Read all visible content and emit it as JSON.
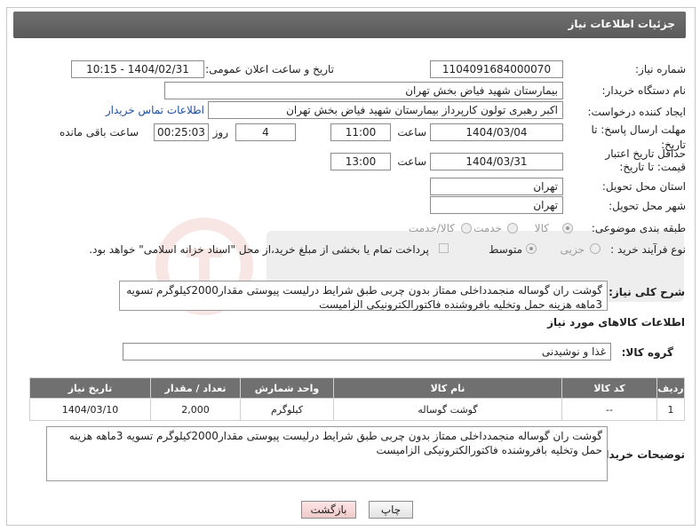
{
  "header": {
    "title": "جزئیات اطلاعات نیاز"
  },
  "form": {
    "need_number_label": "شماره نیاز:",
    "need_number": "1104091684000070",
    "announce_label": "تاریخ و ساعت اعلان عمومی:",
    "announce_value": "1404/02/31 - 10:15",
    "buyer_org_label": "نام دستگاه خریدار:",
    "buyer_org": "بیمارستان شهید فیاض بخش تهران",
    "creator_label": "ایجاد کننده درخواست:",
    "creator": "اکبر رهبری تولون کارپرداز بیمارستان شهید فیاض بخش تهران",
    "buyer_contact_link": "اطلاعات تماس خریدار",
    "reply_deadline_label": "مهلت ارسال پاسخ: تا تاریخ:",
    "reply_date": "1404/03/04",
    "time_label": "ساعت",
    "reply_time": "11:00",
    "days_value": "4",
    "days_label": "روز و",
    "remaining_time": "00:25:03",
    "remaining_label": "ساعت باقی مانده",
    "price_validity_label": "حداقل تاریخ اعتبار قیمت: تا تاریخ:",
    "price_date": "1404/03/31",
    "price_time": "13:00",
    "province_label": "استان محل تحویل:",
    "province": "تهران",
    "city_label": "شهر محل تحویل:",
    "city": "تهران",
    "category_label": "طبقه بندی موضوعی:",
    "category_options": [
      "کالا",
      "خدمت",
      "کالا/خدمت"
    ],
    "process_label": "نوع فرآیند خرید :",
    "process_options": [
      "جزیی",
      "متوسط"
    ],
    "payment_note": "پرداخت تمام یا بخشی از مبلغ خرید،از محل \"اسناد خزانه اسلامی\" خواهد بود.",
    "description_label": "شرح کلی نیاز:",
    "description": "گوشت ران گوساله منجمدداخلی ممتاز بدون چربی طبق شرایط درلیست پیوستی مقدار2000کیلوگرم تسویه 3ماهه هزینه حمل وتخلیه بافروشنده فاکتورالکترونیکی الزامیست"
  },
  "goods": {
    "section_title": "اطلاعات کالاهای مورد نیاز",
    "group_label": "گروه کالا:",
    "group_value": "غذا و نوشیدنی",
    "columns": [
      "ردیف",
      "کد کالا",
      "نام کالا",
      "واحد شمارش",
      "تعداد / مقدار",
      "تاریخ نیاز"
    ],
    "rows": [
      {
        "row": "1",
        "code": "--",
        "name": "گوشت گوساله",
        "unit": "کیلوگرم",
        "qty": "2,000",
        "date": "1404/03/10"
      }
    ]
  },
  "buyer_notes": {
    "label": "توضیحات خریدار:",
    "text": "گوشت ران گوساله منجمدداخلی ممتاز بدون چربی طبق شرایط درلیست پیوستی مقدار2000کیلوگرم تسویه 3ماهه هزینه حمل وتخلیه بافروشنده فاکتورالکترونیکی الزامیست"
  },
  "buttons": {
    "print": "چاپ",
    "back": "بازگشت"
  },
  "colors": {
    "header_bg": "#5f5f5f",
    "link": "#1d4fa3",
    "back_button": "#f0caca"
  }
}
